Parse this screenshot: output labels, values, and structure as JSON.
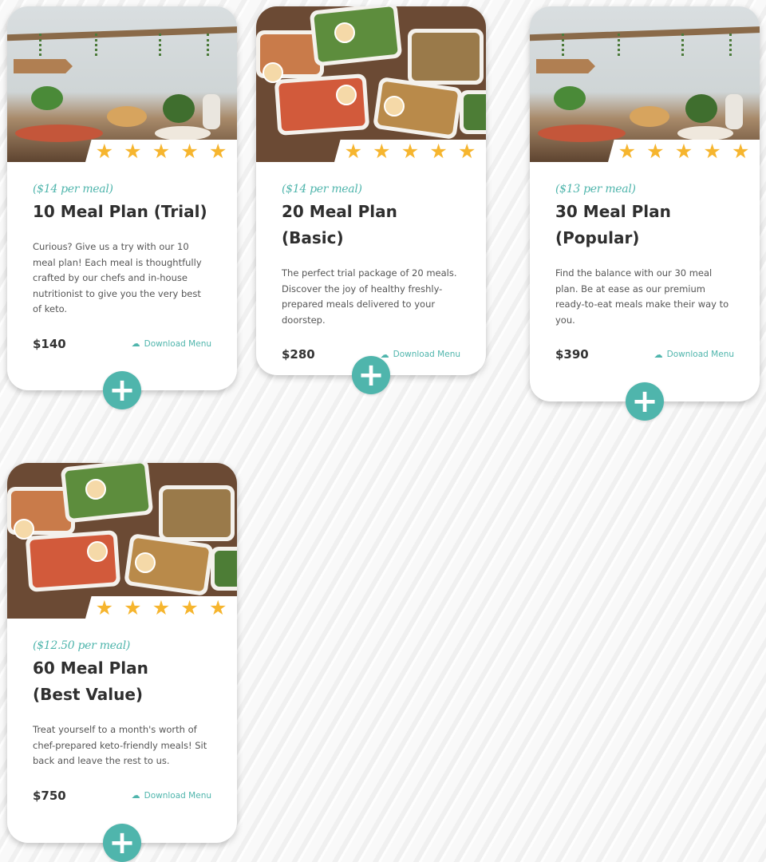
{
  "plans": [
    {
      "per_meal": "($14 per meal)",
      "title": "10 Meal Plan (Trial)",
      "description": "Curious? Give us a try with our 10 meal plan! Each meal is thoughtfully crafted by our chefs and in-house nutritionist to give you the very best of keto.",
      "price": "$140",
      "download_label": "Download Menu",
      "rating": 5,
      "image": "kitchen-table-photo"
    },
    {
      "per_meal": "($14 per meal)",
      "title": "20 Meal Plan (Basic)",
      "description": "The perfect trial package of 20 meals. Discover the joy of healthy freshly-prepared meals delivered to your doorstep.",
      "price": "$280",
      "download_label": "Download Menu",
      "rating": 5,
      "image": "meal-boxes-photo"
    },
    {
      "per_meal": "($13 per meal)",
      "title": "30 Meal Plan (Popular)",
      "description": "Find the balance with our 30 meal plan. Be at ease as our premium ready-to-eat meals make their way to you.",
      "price": "$390",
      "download_label": "Download Menu",
      "rating": 5,
      "image": "kitchen-table-photo"
    },
    {
      "per_meal": "($12.50 per meal)",
      "title": "60 Meal Plan (Best Value)",
      "description": "Treat yourself to a month's worth of chef-prepared keto-friendly meals! Sit back and leave the rest to us.",
      "price": "$750",
      "download_label": "Download Menu",
      "rating": 5,
      "image": "meal-boxes-photo"
    }
  ],
  "icons": {
    "star": "star-icon",
    "download": "cloud-download-icon",
    "add": "plus-icon"
  },
  "colors": {
    "accent": "#4fb5ac",
    "star": "#f6b52e",
    "text": "#2f2f2f"
  }
}
